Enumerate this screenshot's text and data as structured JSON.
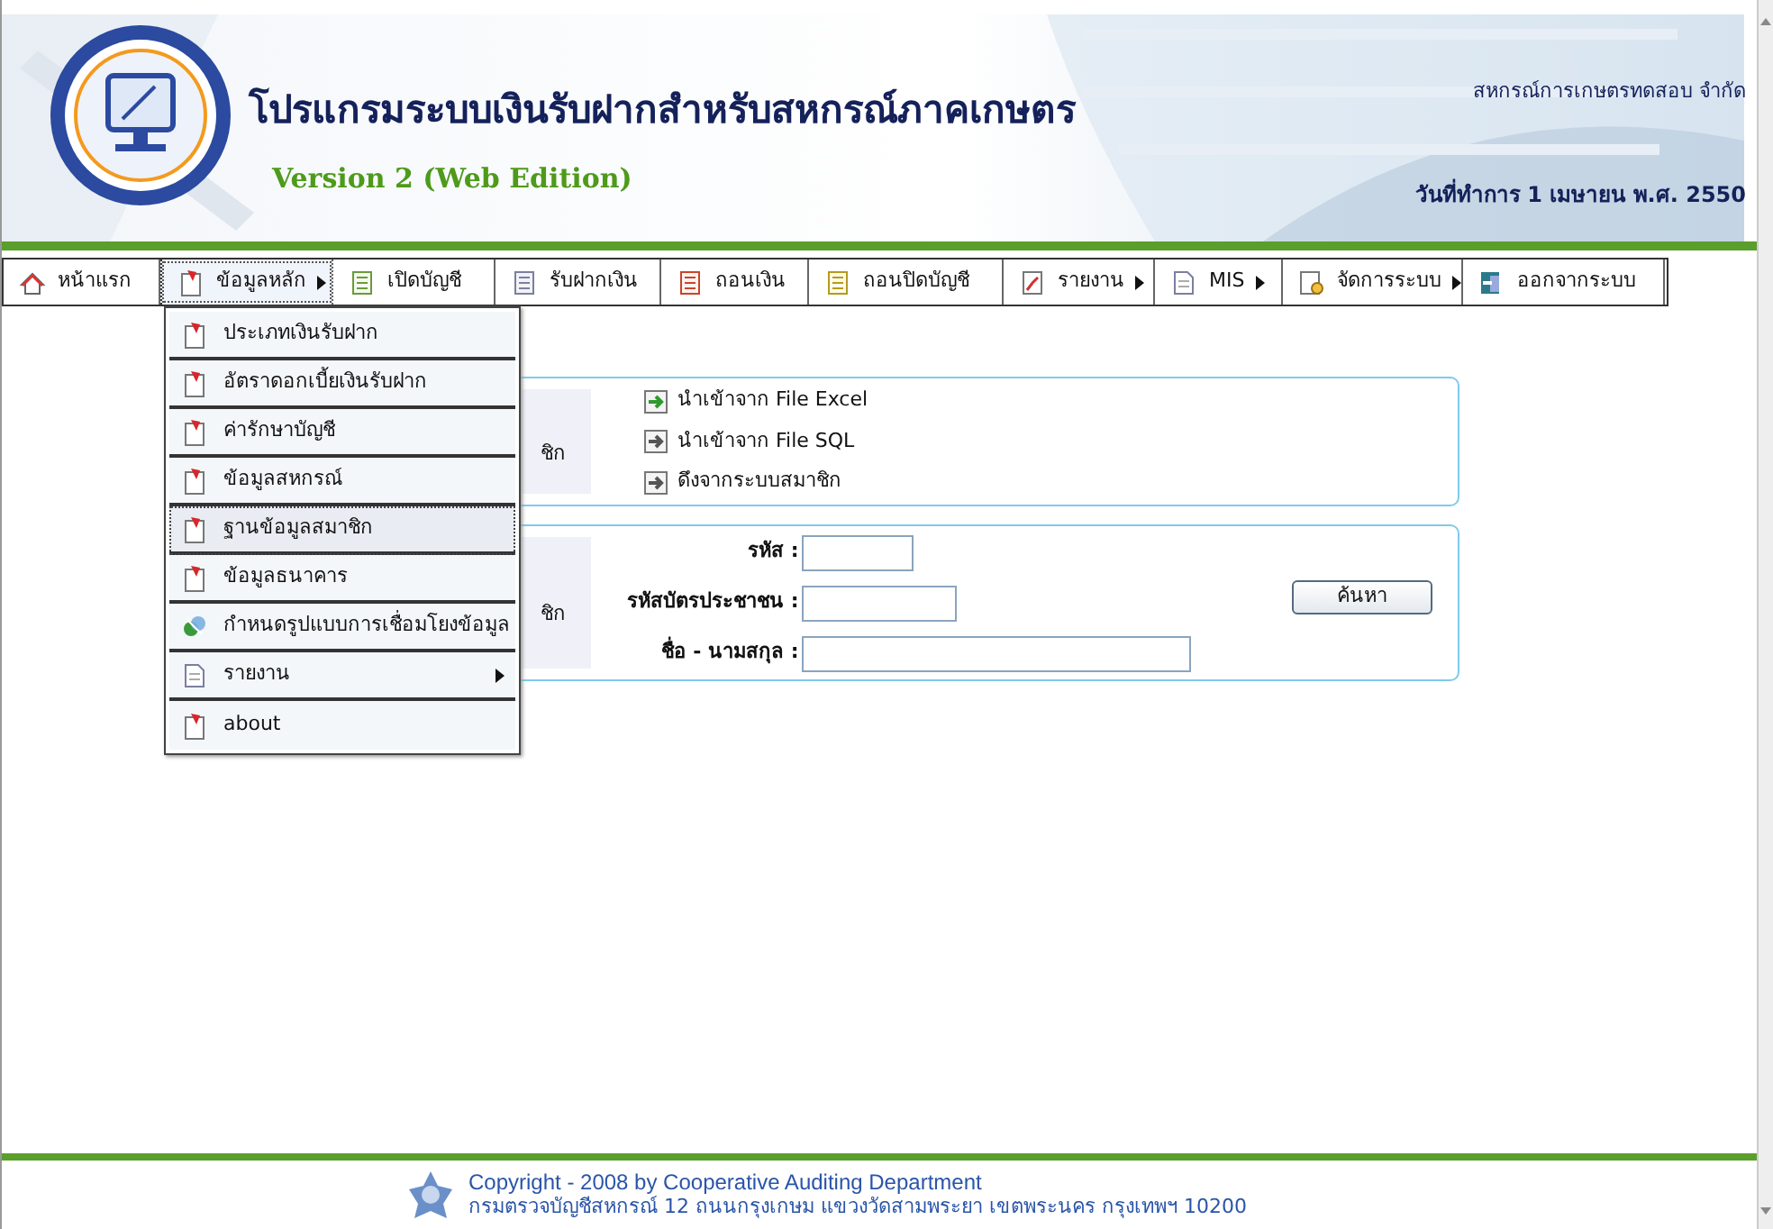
{
  "header": {
    "title": "โปรแกรมระบบเงินรับฝากสำหรับสหกรณ์ภาคเกษตร",
    "version": "Version 2 (Web Edition)",
    "cooperative": "สหกรณ์การเกษตรทดสอบ จำกัด",
    "work_date": "วันที่ทำการ 1 เมษายน พ.ศ. 2550"
  },
  "menu": [
    {
      "label": "หน้าแรก",
      "selected": false,
      "has_submenu": false
    },
    {
      "label": "ข้อมูลหลัก",
      "selected": true,
      "has_submenu": true
    },
    {
      "label": "เปิดบัญชี",
      "selected": false,
      "has_submenu": false
    },
    {
      "label": "รับฝากเงิน",
      "selected": false,
      "has_submenu": false
    },
    {
      "label": "ถอนเงิน",
      "selected": false,
      "has_submenu": false
    },
    {
      "label": "ถอนปิดบัญชี",
      "selected": false,
      "has_submenu": false
    },
    {
      "label": "รายงาน",
      "selected": false,
      "has_submenu": true
    },
    {
      "label": "MIS",
      "selected": false,
      "has_submenu": true
    },
    {
      "label": "จัดการระบบ",
      "selected": false,
      "has_submenu": true
    },
    {
      "label": "ออกจากระบบ",
      "selected": false,
      "has_submenu": false
    }
  ],
  "dropdown": [
    {
      "label": "ประเภทเงินรับฝาก",
      "selected": false,
      "has_submenu": false
    },
    {
      "label": "อัตราดอกเบี้ยเงินรับฝาก",
      "selected": false,
      "has_submenu": false
    },
    {
      "label": "ค่ารักษาบัญชี",
      "selected": false,
      "has_submenu": false
    },
    {
      "label": "ข้อมูลสหกรณ์",
      "selected": false,
      "has_submenu": false
    },
    {
      "label": "ฐานข้อมูลสมาชิก",
      "selected": true,
      "has_submenu": false
    },
    {
      "label": "ข้อมูลธนาคาร",
      "selected": false,
      "has_submenu": false
    },
    {
      "label": "กำหนดรูปแบบการเชื่อมโยงข้อมูล",
      "selected": false,
      "has_submenu": false
    },
    {
      "label": "รายงาน",
      "selected": false,
      "has_submenu": true
    },
    {
      "label": "about",
      "selected": false,
      "has_submenu": false
    }
  ],
  "import_panel": {
    "label": "ชิก",
    "links": [
      "นำเข้าจาก File Excel",
      "นำเข้าจาก File SQL",
      "ดึงจากระบบสมาชิก"
    ]
  },
  "search_panel": {
    "label": "ชิก",
    "fields": [
      {
        "label": "รหัส :"
      },
      {
        "label": "รหัสบัตรประชาชน :"
      },
      {
        "label": "ชื่อ - นามสกุล :"
      }
    ],
    "button": "ค้นหา"
  },
  "footer": {
    "copyright": "Copyright - 2008 by Cooperative Auditing Department",
    "address": "กรมตรวจบัญชีสหกรณ์ 12 ถนนกรุงเกษม แขวงวัดสามพระยา เขตพระนคร กรุงเทพฯ 10200"
  }
}
